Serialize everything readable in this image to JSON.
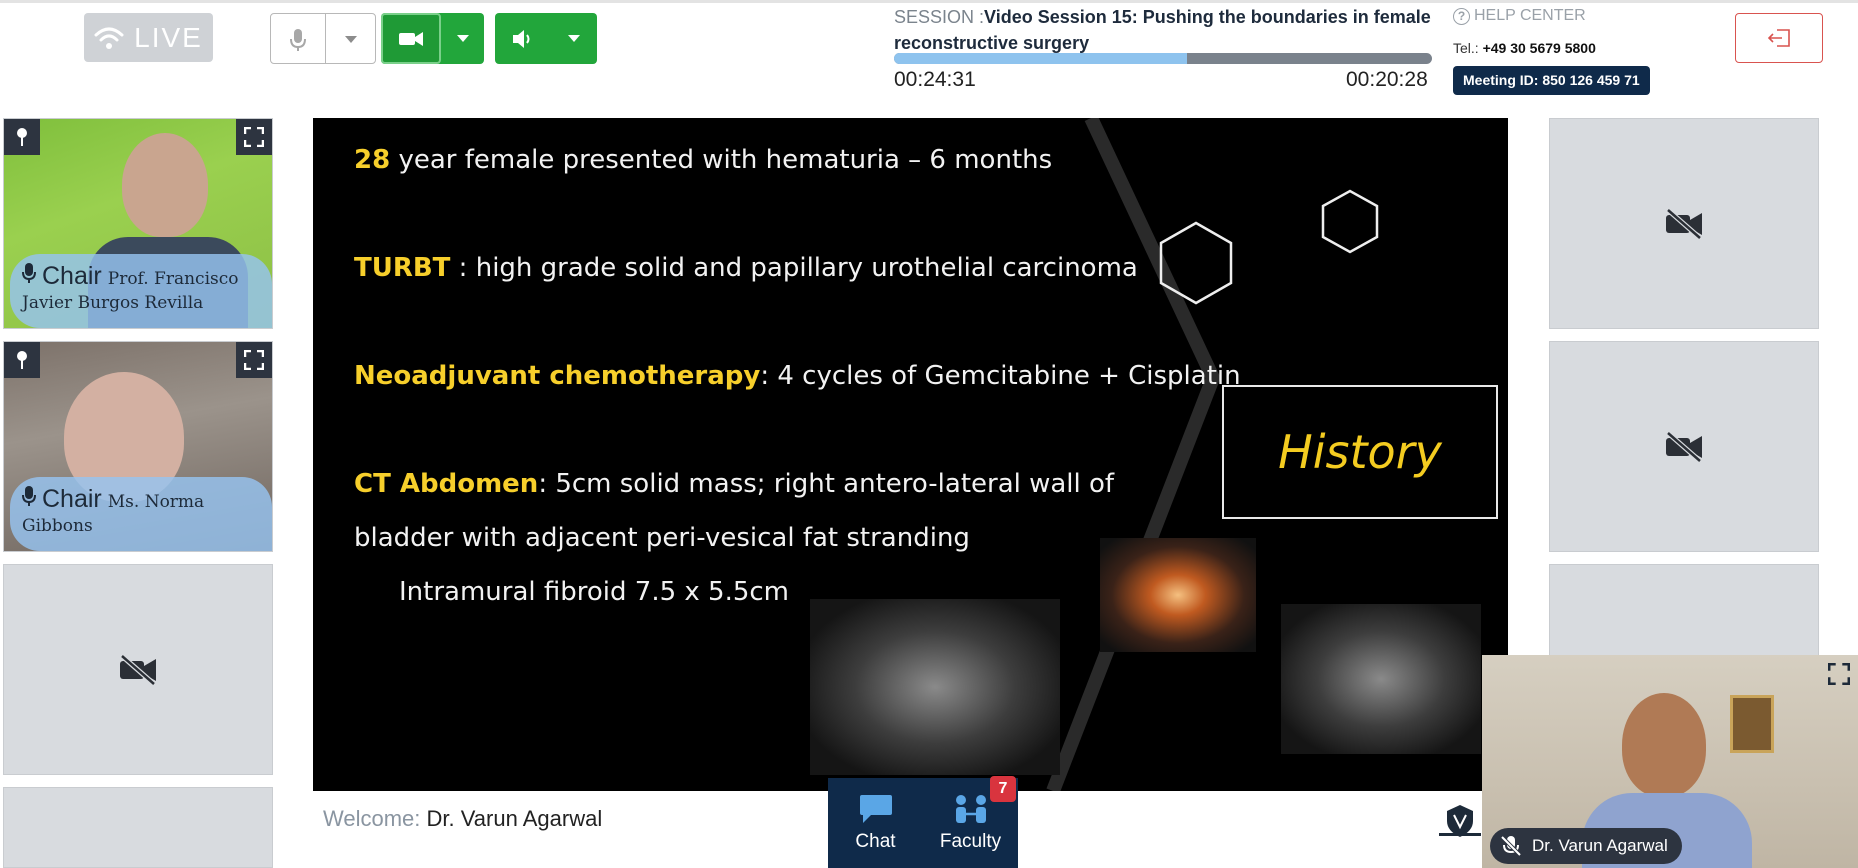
{
  "header": {
    "live_label": "LIVE",
    "session_label": "SESSION :",
    "session_title": "Video Session 15: Pushing the boundaries in female reconstructive surgery",
    "progress": 0.545,
    "time_elapsed": "00:24:31",
    "time_remaining": "00:20:28",
    "help_label": "HELP CENTER",
    "tel_label": "Tel.:",
    "tel_number": "+49 30 5679 5800",
    "meeting_id": "Meeting ID: 850 126 459 71"
  },
  "left_panel": {
    "tiles": [
      {
        "role": "Chair",
        "name_line1": "Prof. Francisco",
        "name_line2": "Javier Burgos Revilla"
      },
      {
        "role": "Chair",
        "name_line1": "Ms. Norma",
        "name_line2": "Gibbons"
      }
    ]
  },
  "slide": {
    "line1_hl": "28",
    "line1_text": " year female presented with hematuria – 6 months",
    "line2_hl": "TURBT",
    "line2_text": " : high grade solid and papillary urothelial carcinoma",
    "line3_hl": "Neoadjuvant chemotherapy",
    "line3_text": ": 4 cycles of Gemcitabine + Cisplatin",
    "line4_hl": "CT Abdomen",
    "line4_text": ": 5cm solid mass; right antero-lateral wall of",
    "line5_text": "bladder with adjacent peri-vesical fat stranding",
    "line6_text": "Intramural fibroid 7.5 x 5.5cm",
    "history_label": "History"
  },
  "self_view": {
    "name": "Dr. Varun Agarwal"
  },
  "footer": {
    "welcome_label": "Welcome:",
    "welcome_name": "Dr. Varun Agarwal",
    "chat_label": "Chat",
    "faculty_label": "Faculty",
    "faculty_count": "7"
  },
  "colors": {
    "accent_green": "#22a63b",
    "navy": "#0f2a4a",
    "slide_highlight": "#f7cf2b",
    "chair_band": "#96c3f0",
    "badge_red": "#d9343e"
  },
  "icons": [
    "wifi-icon",
    "mic-icon",
    "video-camera-icon",
    "speaker-icon",
    "help-icon",
    "exit-icon",
    "pin-icon",
    "fullscreen-icon",
    "video-off-icon",
    "chat-icon",
    "faculty-icon",
    "mic-off-icon"
  ]
}
